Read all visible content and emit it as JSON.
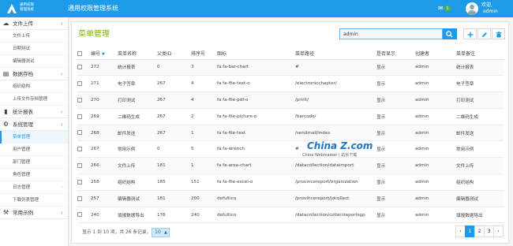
{
  "app": {
    "logo_text_1": "通用权限",
    "logo_text_2": "管理系统",
    "title": "通用权限管理系统"
  },
  "user": {
    "notification_count": "1",
    "welcome": "欢迎,",
    "name": "admin"
  },
  "sidebar": {
    "groups": [
      {
        "label": "文件上传",
        "icon": "cloud-upload-icon",
        "chevron": "‹",
        "items": [
          {
            "label": "文件上传"
          },
          {
            "label": "日期测试"
          },
          {
            "label": "编辑器测试"
          }
        ]
      },
      {
        "label": "数据存档",
        "icon": "archive-icon",
        "chevron": "›",
        "items": [
          {
            "label": "组织结构"
          },
          {
            "label": "上传文件存档管理"
          }
        ]
      },
      {
        "label": "统计报表",
        "icon": "bar-chart-icon",
        "chevron": "›",
        "items": []
      },
      {
        "label": "系统管理",
        "icon": "gear-icon",
        "chevron": "‹",
        "items": [
          {
            "label": "菜单管理",
            "active": true
          },
          {
            "label": "用户管理"
          },
          {
            "label": "部门管理"
          },
          {
            "label": "角色管理"
          },
          {
            "label": "日志管理"
          },
          {
            "label": "下载列表管理"
          }
        ]
      },
      {
        "label": "常用示例",
        "icon": "wrench-icon",
        "chevron": "‹",
        "items": []
      }
    ]
  },
  "main": {
    "title": "菜单管理",
    "search": {
      "value": "admin",
      "placeholder": ""
    },
    "columns": [
      "",
      "编号",
      "菜单名称",
      "父类ID",
      "排序号",
      "图标",
      "菜单路径",
      "是否显示",
      "创建者",
      "菜单备注"
    ],
    "rows": [
      [
        "272",
        "统计报表",
        "0",
        "3",
        "fa fa-bar-chart",
        "#",
        "显示",
        "admin",
        "统计报表"
      ],
      [
        "271",
        "电子签章",
        "267",
        "4",
        "fa fa-file-text-o",
        "/electronicchapter/",
        "显示",
        "admin",
        "电子签章"
      ],
      [
        "270",
        "打印测试",
        "267",
        "4",
        "fa fa-file-pdf-o",
        "/print/",
        "显示",
        "admin",
        "打印测试"
      ],
      [
        "269",
        "二维码生成",
        "267",
        "2",
        "fa fa-file-picture-o",
        "/barcode/",
        "显示",
        "admin",
        "二维码生成"
      ],
      [
        "268",
        "邮件发送",
        "267",
        "1",
        "fa fa-file-text",
        "/sendmail/index",
        "显示",
        "admin",
        "邮件发送"
      ],
      [
        "267",
        "常用示例",
        "0",
        "5",
        "fa fa-wrench",
        "#",
        "显示",
        "admin",
        "常用示例"
      ],
      [
        "266",
        "文件上传",
        "181",
        "1",
        "fa fa-area-chart",
        "/datacollection/dataimport",
        "显示",
        "admin",
        "文件上传"
      ],
      [
        "258",
        "组织结构",
        "185",
        "151",
        "fa fa-file-excel-o",
        "/provincereport/organization",
        "显示",
        "admin",
        "组织结构"
      ],
      [
        "257",
        "编辑器测试",
        "181",
        "200",
        "defultico",
        "/provincereport/jdcollect",
        "显示",
        "admin",
        "编辑器测试"
      ],
      [
        "240",
        "填报数据导出",
        "176",
        "240",
        "defultico",
        "/datacollection/collectreportsgp",
        "显示",
        "admin",
        "填报数据导出"
      ]
    ],
    "footer": {
      "info": "显示 1 到 10 项，共 26 条记录，",
      "page_size": "10"
    },
    "pages": [
      "‹",
      "1",
      "2",
      "3",
      "›"
    ],
    "current_page": "1"
  },
  "watermark": {
    "main": "China Z.com",
    "sub": "China Webmaster | 站长下载"
  },
  "colors": {
    "accent": "#1e9be8",
    "title_green": "#7ab800"
  }
}
